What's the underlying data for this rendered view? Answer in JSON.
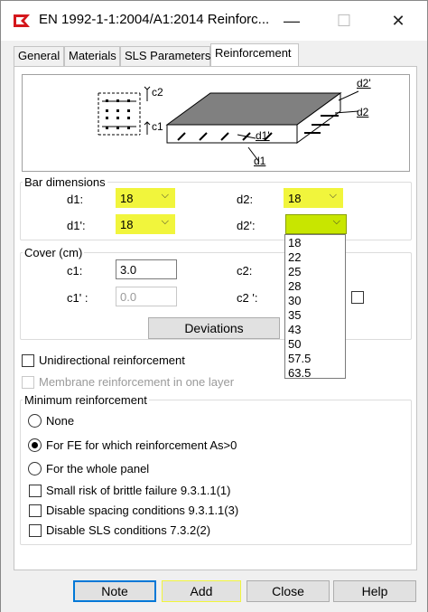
{
  "window": {
    "title": "EN 1992-1-1:2004/A1:2014 Reinforc...",
    "minimize": "—",
    "maximize": "☐",
    "close": "✕"
  },
  "tabs": [
    "General",
    "Materials",
    "SLS Parameters",
    "Reinforcement"
  ],
  "diagram": {
    "labels": {
      "c2": "c2",
      "c1": "c1",
      "d2p": "d2'",
      "d2": "d2",
      "d1p": "d1'",
      "d1": "d1"
    }
  },
  "bar_dimensions": {
    "legend": "Bar dimensions",
    "d1": {
      "label": "d1:",
      "value": "18"
    },
    "d2": {
      "label": "d2:",
      "value": "18"
    },
    "d1p": {
      "label": "d1':",
      "value": "18"
    },
    "d2p": {
      "label": "d2':",
      "value": ""
    }
  },
  "cover": {
    "legend": "Cover (cm)",
    "c1": {
      "label": "c1:",
      "value": "3.0"
    },
    "c2": {
      "label": "c2:"
    },
    "c1p": {
      "label": "c1' :",
      "value": "0.0"
    },
    "c2p": {
      "label": "c2 ':"
    },
    "deviations_button": "Deviations"
  },
  "dropdown_options": [
    "18",
    "22",
    "25",
    "28",
    "30",
    "35",
    "43",
    "50",
    "57.5",
    "63.5"
  ],
  "unidirectional": "Unidirectional reinforcement",
  "membrane": "Membrane reinforcement in one layer",
  "min_reinf": {
    "legend": "Minimum reinforcement",
    "none": "None",
    "fe": "For FE for which reinforcement As>0",
    "whole": "For the whole panel",
    "brittle": "Small risk of brittle failure  9.3.1.1(1)",
    "spacing": "Disable spacing conditions 9.3.1.1(3)",
    "sls": "Disable SLS conditions 7.3.2(2)"
  },
  "buttons": {
    "note": "Note",
    "add": "Add",
    "close": "Close",
    "help": "Help"
  },
  "colors": {
    "highlight": "#f1f53c",
    "selected_combo": "#c8e600",
    "focus_border": "#0078d7"
  }
}
